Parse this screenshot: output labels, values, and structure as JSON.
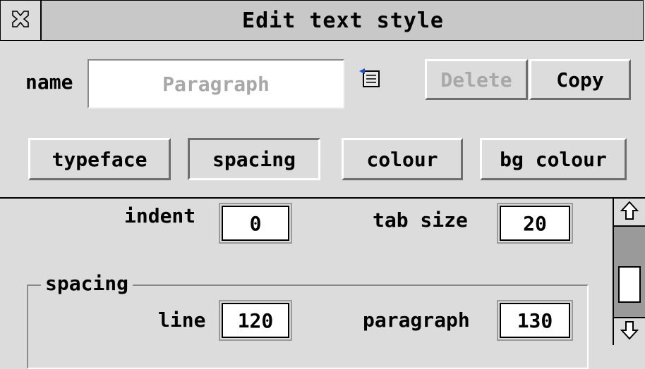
{
  "window": {
    "title": "Edit text style"
  },
  "name_row": {
    "label": "name",
    "value": "Paragraph",
    "delete_label": "Delete",
    "copy_label": "Copy"
  },
  "tabs": [
    {
      "label": "typeface"
    },
    {
      "label": "spacing"
    },
    {
      "label": "colour"
    },
    {
      "label": "bg colour"
    }
  ],
  "spacing_pane": {
    "indent_label": "indent",
    "indent_value": "0",
    "tab_size_label": "tab size",
    "tab_size_value": "20",
    "group_label": "spacing",
    "line_label": "line",
    "line_value": "120",
    "paragraph_label": "paragraph",
    "paragraph_value": "130"
  },
  "icons": {
    "close": "close-icon",
    "menu": "popup-menu-icon",
    "scroll_up": "arrow-up-icon",
    "scroll_down": "arrow-down-icon"
  }
}
